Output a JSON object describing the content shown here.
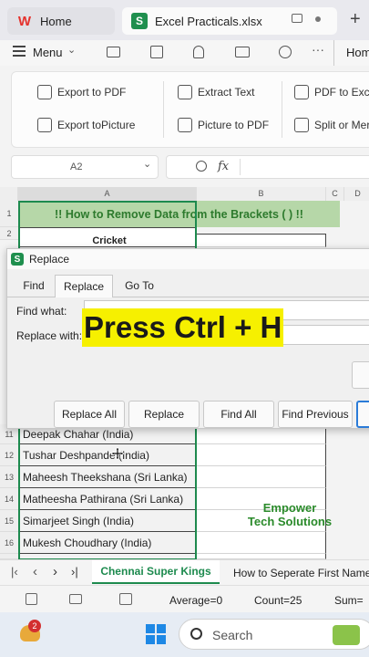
{
  "tabs": {
    "home_label": "Home",
    "file_label": "Excel Practicals.xlsx",
    "new_tab_label": "+"
  },
  "menu": {
    "menu_label": "Menu",
    "home_label": "Hom"
  },
  "ribbon": {
    "export_pdf": "Export to PDF",
    "export_picture": "Export toPicture",
    "extract_text": "Extract Text",
    "picture_to_pdf": "Picture to PDF",
    "pdf_to_excel": "PDF to Exce",
    "split_merge": "Split or Mer"
  },
  "formula_bar": {
    "cell_ref": "A2",
    "fx_label": "fx"
  },
  "grid": {
    "columns": [
      "A",
      "B",
      "C",
      "D"
    ],
    "title": "!! How to Remove Data from the Brackets ( ) !!",
    "header_cell": "Cricket",
    "rows": [
      {
        "num": "1"
      },
      {
        "num": "2"
      },
      {
        "num": "11",
        "a": "Deepak Chahar (India)"
      },
      {
        "num": "12",
        "a": "Tushar Deshpande (India)"
      },
      {
        "num": "13",
        "a": "Maheesh Theekshana (Sri Lanka)"
      },
      {
        "num": "14",
        "a": "Matheesha Pathirana (Sri Lanka)"
      },
      {
        "num": "15",
        "a": "Simarjeet Singh (India)"
      },
      {
        "num": "16",
        "a": "Mukesh Choudhary (India)"
      }
    ]
  },
  "dialog": {
    "title": "Replace",
    "tabs": [
      "Find",
      "Replace",
      "Go To"
    ],
    "find_what_label": "Find what:",
    "replace_with_label": "Replace with:",
    "buttons": [
      "Replace All",
      "Replace",
      "Find All",
      "Find Previous"
    ]
  },
  "overlay_text": "Press Ctrl + H",
  "watermark": {
    "line1": "Empower",
    "line2": "Tech Solutions"
  },
  "sheet_tabs": {
    "active": "Chennai Super Kings",
    "other": "How to Seperate First Name"
  },
  "status": {
    "average": "Average=0",
    "count": "Count=25",
    "sum": "Sum="
  },
  "taskbar": {
    "badge": "2",
    "search_placeholder": "Search"
  }
}
